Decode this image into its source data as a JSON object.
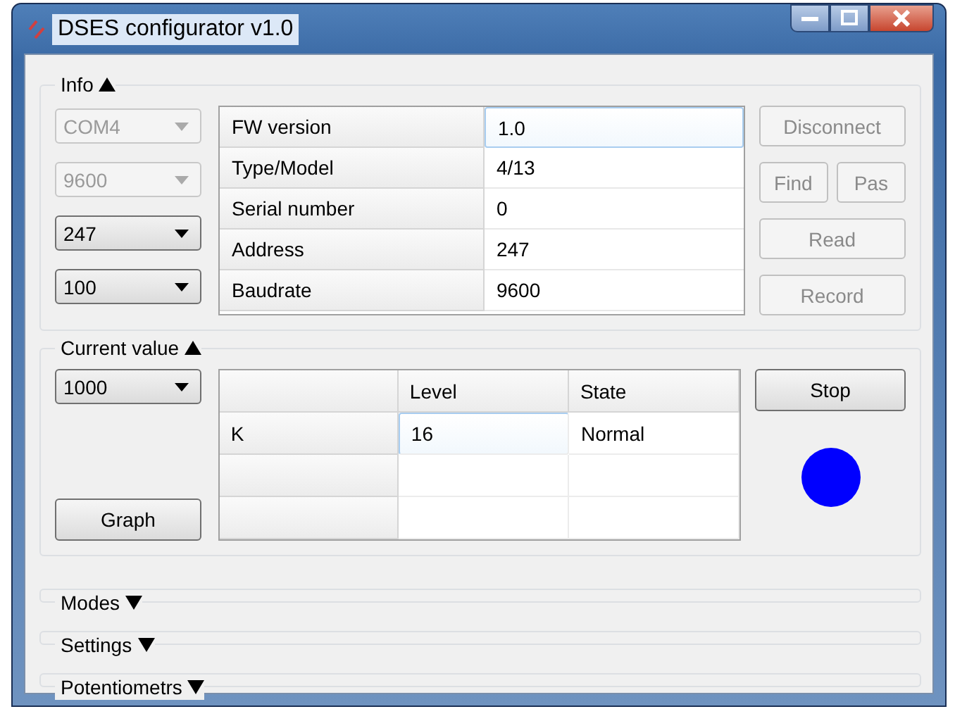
{
  "window": {
    "title": "DSES configurator v1.0"
  },
  "info": {
    "title": "Info",
    "expanded": true,
    "combos": [
      {
        "value": "COM4",
        "disabled": true
      },
      {
        "value": "9600",
        "disabled": true
      },
      {
        "value": "247",
        "disabled": false
      },
      {
        "value": "100",
        "disabled": false
      }
    ],
    "rows": [
      {
        "label": "FW version",
        "value": "1.0",
        "selected": true
      },
      {
        "label": "Type/Model",
        "value": "4/13",
        "selected": false
      },
      {
        "label": "Serial number",
        "value": "0",
        "selected": false
      },
      {
        "label": "Address",
        "value": "247",
        "selected": false
      },
      {
        "label": "Baudrate",
        "value": "9600",
        "selected": false
      }
    ],
    "button_rows": [
      [
        {
          "label": "Disconnect",
          "disabled": true
        }
      ],
      [
        {
          "label": "Find",
          "disabled": true
        },
        {
          "label": "Pas",
          "disabled": true
        }
      ],
      [
        {
          "label": "Read",
          "disabled": true
        }
      ],
      [
        {
          "label": "Record",
          "disabled": true
        }
      ]
    ]
  },
  "current_value": {
    "title": "Current value",
    "expanded": true,
    "combo": {
      "value": "1000",
      "disabled": false
    },
    "graph_button": "Graph",
    "columns": [
      "Level",
      "State"
    ],
    "rows": [
      {
        "header": "K",
        "cells": [
          {
            "text": "16",
            "selected": true
          },
          {
            "text": "Normal",
            "selected": false
          }
        ]
      }
    ],
    "stop_button": "Stop",
    "indicator": {
      "color": "#0000ff"
    }
  },
  "collapsed_sections": [
    {
      "title": "Modes",
      "expanded": false
    },
    {
      "title": "Settings",
      "expanded": false
    },
    {
      "title": "Potentiometrs",
      "expanded": false
    }
  ]
}
